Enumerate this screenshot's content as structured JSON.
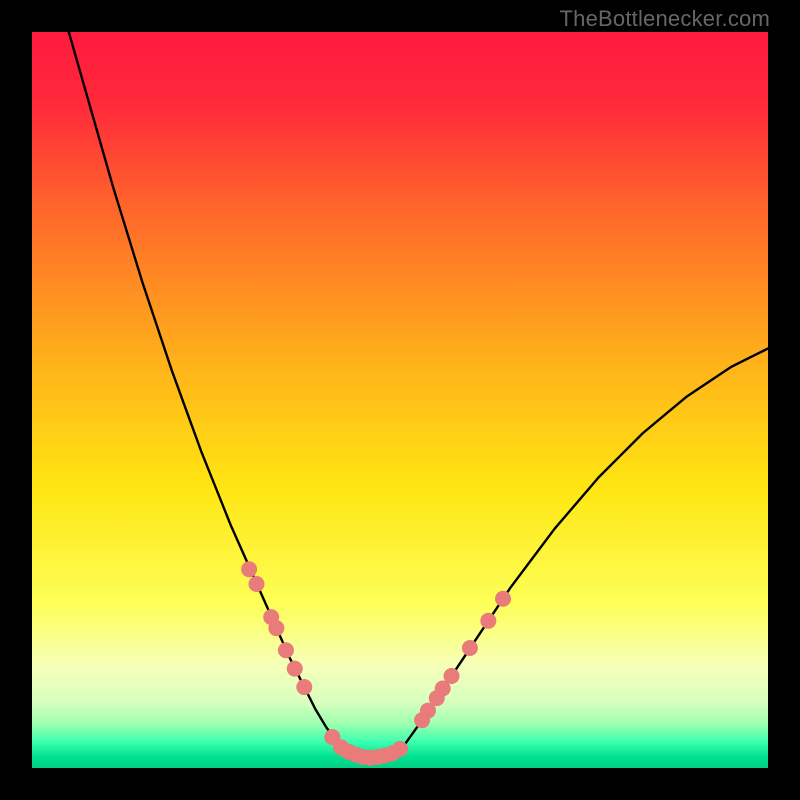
{
  "watermark": "TheBottlenecker.com",
  "chart_data": {
    "type": "line",
    "title": "",
    "xlabel": "",
    "ylabel": "",
    "xlim": [
      0,
      100
    ],
    "ylim": [
      0,
      100
    ],
    "grid": false,
    "legend": false,
    "background": {
      "type": "vertical_gradient",
      "stops": [
        {
          "pos": 0.0,
          "color": "#ff1a3f"
        },
        {
          "pos": 0.1,
          "color": "#ff2a3a"
        },
        {
          "pos": 0.25,
          "color": "#ff6a2a"
        },
        {
          "pos": 0.45,
          "color": "#ffb21a"
        },
        {
          "pos": 0.62,
          "color": "#ffe612"
        },
        {
          "pos": 0.78,
          "color": "#fdff5a"
        },
        {
          "pos": 0.86,
          "color": "#f6ffb8"
        },
        {
          "pos": 0.91,
          "color": "#d8ffbf"
        },
        {
          "pos": 0.94,
          "color": "#9effb0"
        },
        {
          "pos": 0.965,
          "color": "#3affb0"
        },
        {
          "pos": 0.985,
          "color": "#00e28f"
        },
        {
          "pos": 1.0,
          "color": "#00d084"
        }
      ]
    },
    "series": [
      {
        "name": "left-arm",
        "color": "#000000",
        "x": [
          5,
          7,
          9,
          11,
          13,
          15,
          17,
          19,
          21,
          23,
          25,
          27,
          29,
          31,
          33,
          35,
          37,
          38.5,
          40,
          41.5,
          43
        ],
        "y": [
          100,
          93,
          86,
          79,
          72.5,
          66,
          60,
          54,
          48.5,
          43,
          38,
          33,
          28.5,
          24,
          19.5,
          15,
          11,
          8,
          5.5,
          3.5,
          2.2
        ]
      },
      {
        "name": "trough",
        "color": "#000000",
        "x": [
          43,
          44.5,
          46,
          47.5,
          49,
          50.5
        ],
        "y": [
          2.2,
          1.6,
          1.4,
          1.5,
          2.0,
          3.0
        ]
      },
      {
        "name": "right-arm",
        "color": "#000000",
        "x": [
          50.5,
          53,
          56,
          59,
          62,
          65,
          68,
          71,
          74,
          77,
          80,
          83,
          86,
          89,
          92,
          95,
          98,
          100
        ],
        "y": [
          3.0,
          6.5,
          11,
          15.5,
          20,
          24.5,
          28.5,
          32.5,
          36,
          39.5,
          42.5,
          45.5,
          48,
          50.5,
          52.5,
          54.5,
          56,
          57
        ]
      }
    ],
    "marker_points": {
      "name": "highlight-dots",
      "color": "#e97b7b",
      "radius": 8,
      "points": [
        {
          "x": 29.5,
          "y": 27
        },
        {
          "x": 30.5,
          "y": 25
        },
        {
          "x": 32.5,
          "y": 20.5
        },
        {
          "x": 33.2,
          "y": 19
        },
        {
          "x": 34.5,
          "y": 16
        },
        {
          "x": 35.7,
          "y": 13.5
        },
        {
          "x": 37.0,
          "y": 11
        },
        {
          "x": 40.8,
          "y": 4.2
        },
        {
          "x": 42.0,
          "y": 2.8
        },
        {
          "x": 43.0,
          "y": 2.2
        },
        {
          "x": 44.0,
          "y": 1.8
        },
        {
          "x": 45.0,
          "y": 1.5
        },
        {
          "x": 46.0,
          "y": 1.4
        },
        {
          "x": 47.0,
          "y": 1.5
        },
        {
          "x": 48.0,
          "y": 1.7
        },
        {
          "x": 49.0,
          "y": 2.0
        },
        {
          "x": 50.0,
          "y": 2.6
        },
        {
          "x": 53.0,
          "y": 6.5
        },
        {
          "x": 53.8,
          "y": 7.8
        },
        {
          "x": 55.0,
          "y": 9.5
        },
        {
          "x": 55.8,
          "y": 10.8
        },
        {
          "x": 57.0,
          "y": 12.5
        },
        {
          "x": 59.5,
          "y": 16.3
        },
        {
          "x": 62.0,
          "y": 20.0
        },
        {
          "x": 64.0,
          "y": 23.0
        }
      ]
    }
  }
}
